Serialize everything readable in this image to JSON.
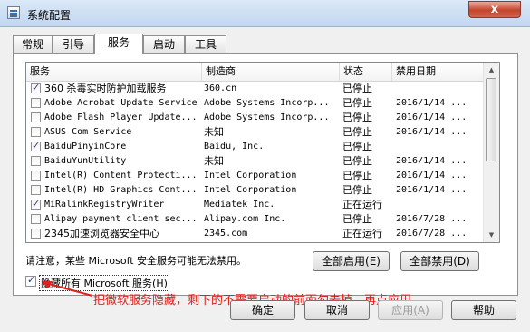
{
  "window": {
    "title": "系统配置",
    "close_label": "x"
  },
  "tabs": [
    {
      "label": "常规",
      "active": false
    },
    {
      "label": "引导",
      "active": false
    },
    {
      "label": "服务",
      "active": true
    },
    {
      "label": "启动",
      "active": false
    },
    {
      "label": "工具",
      "active": false
    }
  ],
  "table": {
    "columns": [
      "服务",
      "制造商",
      "状态",
      "禁用日期"
    ],
    "rows": [
      {
        "checked": true,
        "service": "360 杀毒实时防护加载服务",
        "maker": "360.cn",
        "status": "已停止",
        "date": ""
      },
      {
        "checked": false,
        "service": "Adobe Acrobat Update Service",
        "maker": "Adobe Systems Incorp...",
        "status": "已停止",
        "date": "2016/1/14 ..."
      },
      {
        "checked": false,
        "service": "Adobe Flash Player Update...",
        "maker": "Adobe Systems Incorp...",
        "status": "已停止",
        "date": "2016/1/14 ..."
      },
      {
        "checked": false,
        "service": "ASUS Com Service",
        "maker": "未知",
        "status": "已停止",
        "date": "2016/1/14 ..."
      },
      {
        "checked": true,
        "service": "BaiduPinyinCore",
        "maker": "Baidu, Inc.",
        "status": "已停止",
        "date": ""
      },
      {
        "checked": false,
        "service": "BaiduYunUtility",
        "maker": "未知",
        "status": "已停止",
        "date": "2016/1/14 ..."
      },
      {
        "checked": false,
        "service": "Intel(R) Content Protecti...",
        "maker": "Intel Corporation",
        "status": "已停止",
        "date": "2016/1/14 ..."
      },
      {
        "checked": false,
        "service": "Intel(R) HD Graphics Cont...",
        "maker": "Intel Corporation",
        "status": "已停止",
        "date": "2016/1/14 ..."
      },
      {
        "checked": true,
        "service": "MiRalinkRegistryWriter",
        "maker": "Mediatek Inc.",
        "status": "正在运行",
        "date": ""
      },
      {
        "checked": false,
        "service": "Alipay payment client sec...",
        "maker": "Alipay.com Inc.",
        "status": "已停止",
        "date": "2016/7/28 ..."
      },
      {
        "checked": false,
        "service": "2345加速浏览器安全中心",
        "maker": "2345.com",
        "status": "正在运行",
        "date": "2016/7/28 ..."
      }
    ]
  },
  "scrollbar": {
    "up_icon": "▲",
    "down_icon": "▼"
  },
  "note": "请注意，某些 Microsoft 安全服务可能无法禁用。",
  "buttons": {
    "enable_all": "全部启用(E)",
    "disable_all": "全部禁用(D)",
    "ok": "确定",
    "cancel": "取消",
    "apply": "应用(A)",
    "help": "帮助"
  },
  "hide_microsoft": {
    "label": "隐藏所有 Microsoft 服务(H)",
    "checked": true
  },
  "annotation": "把微软服务隐藏，剩下的不需要启动的前面勾去掉，再点应用",
  "colors": {
    "annotation": "#e0201c",
    "titlebar": "#c2d6ee"
  }
}
